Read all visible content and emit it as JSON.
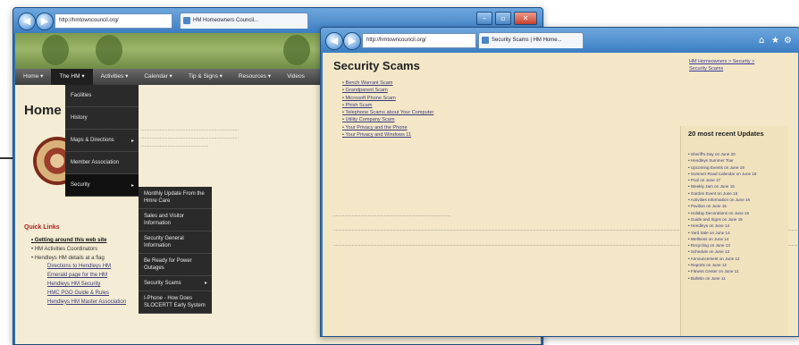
{
  "back_window": {
    "address": "http://hmtowncouncil.org/",
    "tab_title": "HM Homeowners Council...",
    "menu": [
      "Home",
      "The HM",
      "Activities",
      "Calendar",
      "Tip & Signs",
      "Resources",
      "Videos"
    ],
    "dropdown_level1": [
      "Facilities",
      "History",
      "Maps & Directions",
      "Member Association",
      "Security"
    ],
    "dropdown_level2": [
      "Monthly Update From the Hmre Care",
      "Sales and Visitor Information",
      "Security General Information",
      "Be Ready for Power Outages",
      "Security Scams",
      "I-Phone - How Does SLOCERTT Early System"
    ],
    "home_heading": "Home",
    "page_link": "HM",
    "quick_links_heading": "Quick Links",
    "quick_links": [
      {
        "text": "Getting around this web site",
        "style": "bold"
      },
      {
        "text": "HM Activities Coordinators",
        "style": "plain"
      },
      {
        "text": "Hendleys HM details at a flag",
        "style": "plain"
      },
      {
        "text": "Directions to Hendleys HM",
        "style": "sub"
      },
      {
        "text": "Emerald page for the HM",
        "style": "sub"
      },
      {
        "text": "Hendleys HM Security",
        "style": "sub"
      },
      {
        "text": "HMC PGO Guide & Rules",
        "style": "sub"
      },
      {
        "text": "Hendleys HM Master Association",
        "style": "sub"
      }
    ]
  },
  "front_window": {
    "address": "http://hmtowncouncil.org/",
    "tab_title": "Security Scams | HM Home...",
    "title": "Security Scams",
    "scam_links": [
      "Bench Warrant Scam",
      "Grandparent Scam",
      "Microsoft Phone Scam",
      "Phish Scam",
      "Telephone Scams about Your Computer",
      "Utility Company Scam",
      "Your Privacy and the Phone",
      "Your Privacy and Windows 11"
    ],
    "breadcrumb": "HM Homeowners > Security > Security Scams",
    "updates_heading": "20 most recent Updates",
    "updates": [
      "Sheriff's Day on June 20",
      "Hendleys Summer Tour",
      "Upcoming Events on June 18",
      "Summer Road Calendar on June 18",
      "Pool on June 17",
      "Weekly Jam on June 16",
      "Garden Event on June 16",
      "Activities Information on June 16",
      "Pavilion on June 15",
      "Holiday Decorations on June 15",
      "Guide and Signs on June 15",
      "Hendleys on June 14",
      "Yard Sale on June 14",
      "Wellness on June 14",
      "Recycling on June 13",
      "Schedule on June 13",
      "Announcement on June 12",
      "Reports on June 12",
      "Fitness Center on June 11",
      "Bulletin on June 11"
    ]
  }
}
